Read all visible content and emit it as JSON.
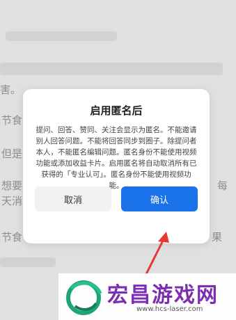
{
  "background": {
    "lines": [
      "",
      "",
      "",
      "害。",
      "节食",
      "但是",
      "想要",
      "每",
      "天消",
      "节食",
      "果"
    ]
  },
  "dialog": {
    "title": "启用匿名后",
    "body": "提问、回答、赞同、关注会显示为匿名。不能邀请别人回答问题。不能将回答同步到圈子。除提问者本人，不能匿名编辑问题。匿名身份不能使用视频功能或添加收益卡片。启用匿名将自动取消所有已获得的「专业认可」。匿名身份不能使用视频功能。",
    "cancel_label": "取消",
    "confirm_label": "确认"
  },
  "watermark": {
    "title": "宏昌游戏网",
    "url": "www.hcs-laser.com"
  },
  "colors": {
    "accent": "#1a73e8",
    "arrow": "#e53935",
    "watermark": "#7b2fb0"
  }
}
